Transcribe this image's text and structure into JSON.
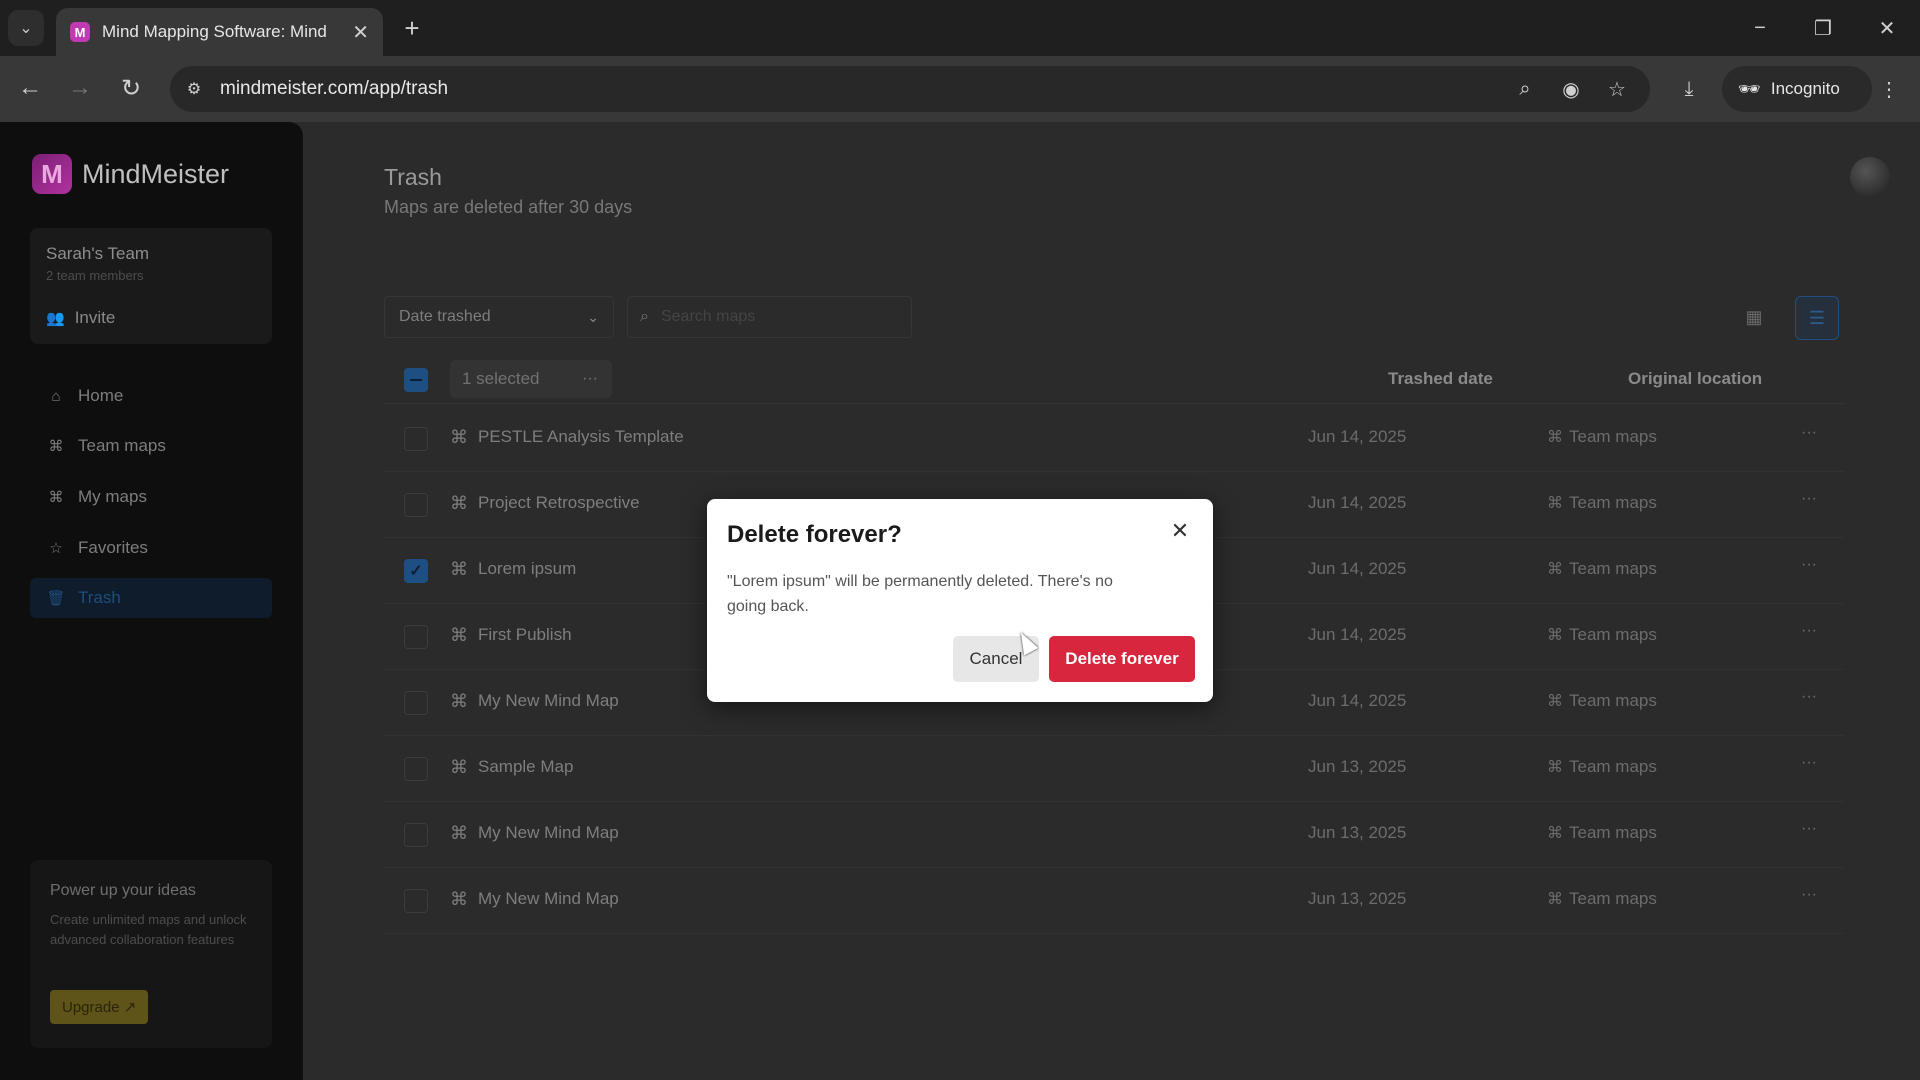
{
  "browser": {
    "tab_title": "Mind Mapping Software: Mind",
    "tab_favicon": "M",
    "url": "mindmeister.com/app/trash",
    "incognito_label": "Incognito"
  },
  "sidebar": {
    "brand_logo": "M",
    "brand_name": "MindMeister",
    "team_name": "Sarah's Team",
    "team_members": "2 team members",
    "invite_label": "Invite",
    "items": [
      {
        "label": "Home",
        "icon": "home-icon"
      },
      {
        "label": "Team maps",
        "icon": "team-maps-icon"
      },
      {
        "label": "My maps",
        "icon": "my-maps-icon"
      },
      {
        "label": "Favorites",
        "icon": "star-icon"
      },
      {
        "label": "Trash",
        "icon": "trash-icon",
        "active": true
      }
    ],
    "promo": {
      "title": "Power up your ideas",
      "text": "Create unlimited maps and unlock advanced collaboration features",
      "button": "Upgrade ↗"
    }
  },
  "main": {
    "title": "Trash",
    "subtitle": "Maps are deleted after 30 days",
    "sort": {
      "selected": "Date trashed"
    },
    "search": {
      "placeholder": "Search maps"
    },
    "selection": {
      "label": "1 selected",
      "more": "···"
    },
    "columns": {
      "trashed_date": "Trashed date",
      "original_location": "Original location"
    },
    "rows": [
      {
        "name": "PESTLE Analysis Template",
        "date": "Jun 14, 2025",
        "location": "Team maps",
        "checked": false,
        "more": "···"
      },
      {
        "name": "Project Retrospective",
        "date": "Jun 14, 2025",
        "location": "Team maps",
        "checked": false,
        "more": "···"
      },
      {
        "name": "Lorem ipsum",
        "date": "Jun 14, 2025",
        "location": "Team maps",
        "checked": true,
        "more": "···"
      },
      {
        "name": "First Publish",
        "date": "Jun 14, 2025",
        "location": "Team maps",
        "checked": false,
        "more": "···"
      },
      {
        "name": "My New Mind Map",
        "date": "Jun 14, 2025",
        "location": "Team maps",
        "checked": false,
        "more": "···"
      },
      {
        "name": "Sample Map",
        "date": "Jun 13, 2025",
        "location": "Team maps",
        "checked": false,
        "more": "···"
      },
      {
        "name": "My New Mind Map",
        "date": "Jun 13, 2025",
        "location": "Team maps",
        "checked": false,
        "more": "···"
      },
      {
        "name": "My New Mind Map",
        "date": "Jun 13, 2025",
        "location": "Team maps",
        "checked": false,
        "more": "···"
      }
    ]
  },
  "modal": {
    "title": "Delete forever?",
    "body": "\"Lorem ipsum\" will be permanently deleted. There's no going back.",
    "cancel": "Cancel",
    "confirm": "Delete forever"
  },
  "colors": {
    "accent": "#1d4f82",
    "danger": "#d7263d",
    "brand": "#b0329f"
  }
}
